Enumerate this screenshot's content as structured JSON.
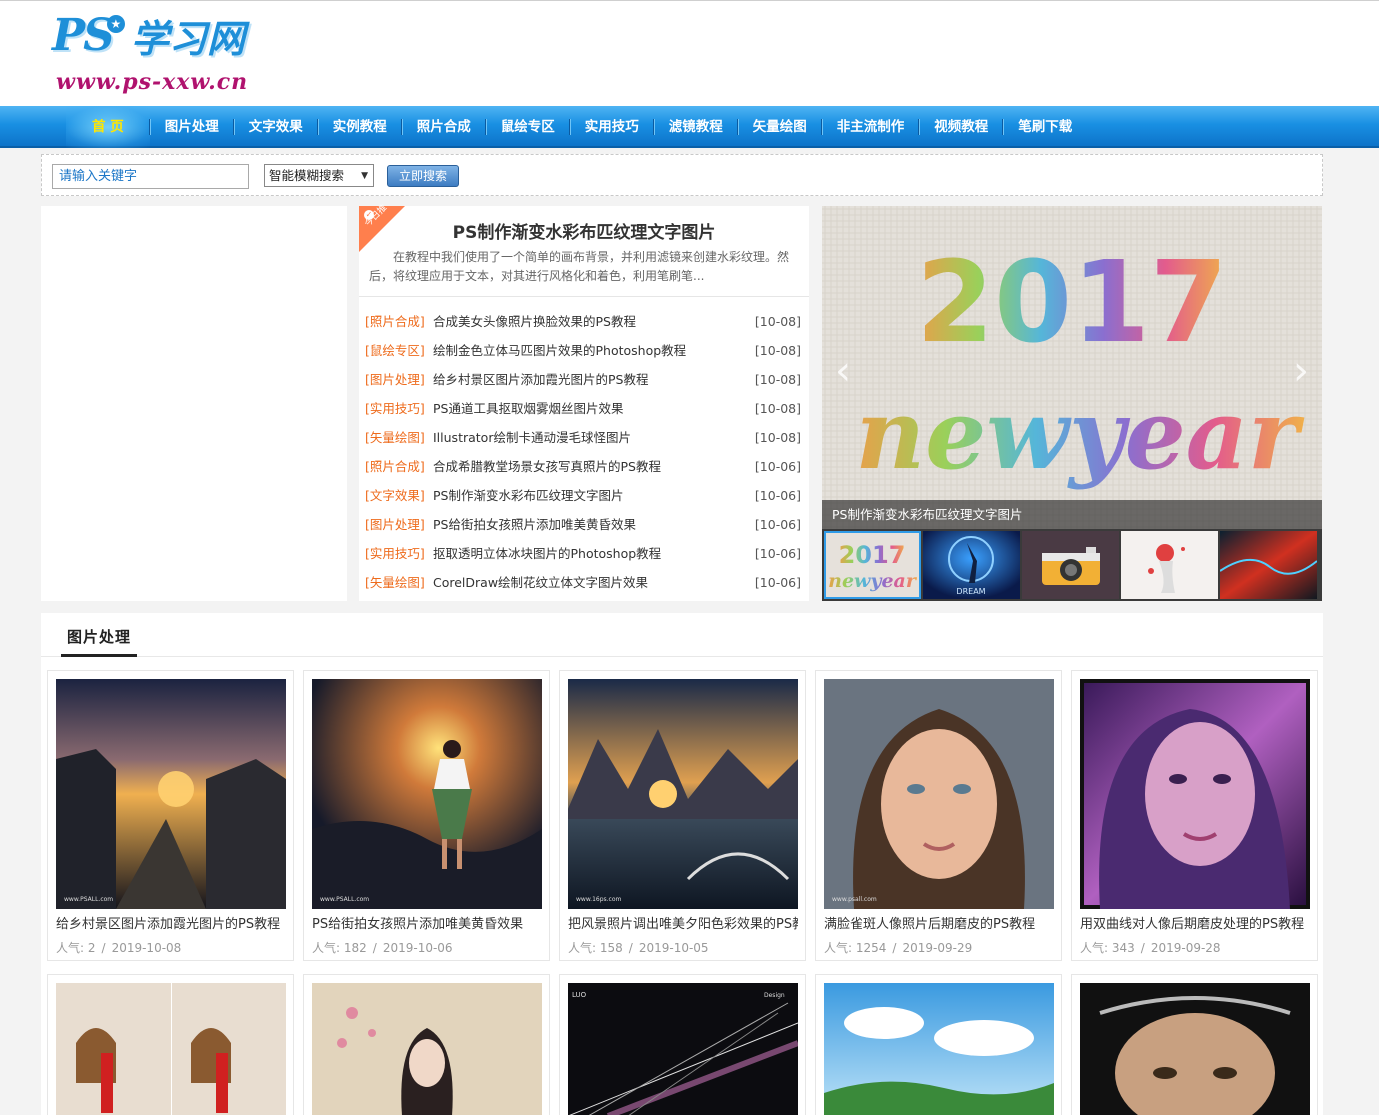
{
  "site": {
    "logo_ps": "PS",
    "logo_cn": "学习网",
    "logo_url": "www.ps-xxw.cn"
  },
  "nav": {
    "items": [
      "首 页",
      "图片处理",
      "文字效果",
      "实例教程",
      "照片合成",
      "鼠绘专区",
      "实用技巧",
      "滤镜教程",
      "矢量绘图",
      "非主流制作",
      "视频教程",
      "笔刷下载"
    ]
  },
  "search": {
    "placeholder": "请输入关键字",
    "mode": "智能模糊搜索",
    "button": "立即搜索"
  },
  "featured": {
    "ribbon": "今日推",
    "title": "PS制作渐变水彩布匹纹理文字图片",
    "summary": "在教程中我们使用了一个简单的画布背景，并利用滤镜来创建水彩纹理。然后，将纹理应用于文本，对其进行风格化和着色，利用笔刷笔..."
  },
  "articles": [
    {
      "cat": "[照片合成]",
      "title": "合成美女头像照片换脸效果的PS教程",
      "date": "[10-08]"
    },
    {
      "cat": "[鼠绘专区]",
      "title": "绘制金色立体马匹图片效果的Photoshop教程",
      "date": "[10-08]"
    },
    {
      "cat": "[图片处理]",
      "title": "给乡村景区图片添加霞光图片的PS教程",
      "date": "[10-08]"
    },
    {
      "cat": "[实用技巧]",
      "title": "PS通道工具抠取烟雾烟丝图片效果",
      "date": "[10-08]"
    },
    {
      "cat": "[矢量绘图]",
      "title": "Illustrator绘制卡通动漫毛球怪图片",
      "date": "[10-08]"
    },
    {
      "cat": "[照片合成]",
      "title": "合成希腊教堂场景女孩写真照片的PS教程",
      "date": "[10-06]"
    },
    {
      "cat": "[文字效果]",
      "title": "PS制作渐变水彩布匹纹理文字图片",
      "date": "[10-06]"
    },
    {
      "cat": "[图片处理]",
      "title": "PS给街拍女孩照片添加唯美黄昏效果",
      "date": "[10-06]"
    },
    {
      "cat": "[实用技巧]",
      "title": "抠取透明立体冰块图片的Photoshop教程",
      "date": "[10-06]"
    },
    {
      "cat": "[矢量绘图]",
      "title": "CorelDraw绘制花纹立体文字图片效果",
      "date": "[10-06]"
    }
  ],
  "slider": {
    "line1": "2017",
    "line2": "newyear",
    "caption": "PS制作渐变水彩布匹纹理文字图片",
    "prev": "‹",
    "next": "›",
    "thumb1_line1": "2017",
    "thumb1_line2": "newyear",
    "thumb2_text": "DREAM"
  },
  "section": {
    "title": "图片处理",
    "meta_label": "人气:",
    "cards": [
      {
        "title": "给乡村景区图片添加霞光图片的PS教程",
        "views": "2",
        "date": "2019-10-08",
        "watermark": "www.PSALL.com"
      },
      {
        "title": "PS给街拍女孩照片添加唯美黄昏效果",
        "views": "182",
        "date": "2019-10-06",
        "watermark": "www.PSALL.com"
      },
      {
        "title": "把风景照片调出唯美夕阳色彩效果的PS教程",
        "views": "158",
        "date": "2019-10-05",
        "watermark": "www.16ps.com"
      },
      {
        "title": "满脸雀斑人像照片后期磨皮的PS教程",
        "views": "1254",
        "date": "2019-09-29",
        "watermark": "www.psall.com"
      },
      {
        "title": "用双曲线对人像后期磨皮处理的PS教程",
        "views": "343",
        "date": "2019-09-28",
        "watermark": ""
      }
    ],
    "row2_labels": {
      "luo": "LUO",
      "design": "Design"
    }
  },
  "colors": {
    "nav_blue": "#1990e3",
    "active_nav": "#ffe600",
    "category_orange": "#ee6b1c",
    "ribbon": "#ff7f4d"
  }
}
